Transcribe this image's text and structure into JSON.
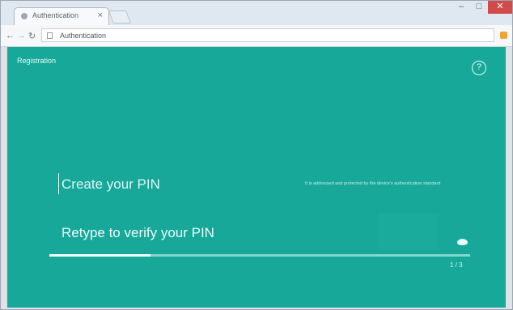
{
  "browser": {
    "tab_title": "Authentication",
    "tab_close": "×",
    "window_controls": {
      "minimize": "–",
      "maximize": "□",
      "close": "✕"
    },
    "nav": {
      "back": "←",
      "forward": "→",
      "reload": "↻"
    },
    "address": "Authentication",
    "menu_icon": "menu-icon"
  },
  "app": {
    "label": "Registration",
    "help_icon": "?",
    "create_pin_label": "Create your PIN",
    "create_pin_hint": "It is addressed and protected by the device's authentication standard",
    "verify_pin_label": "Retype to verify your PIN",
    "progress": 0.24,
    "page_indicator": "1 / 3"
  },
  "colors": {
    "page_background": "#17a899",
    "text": "#e9fdfa",
    "track": "#84d6ce"
  }
}
